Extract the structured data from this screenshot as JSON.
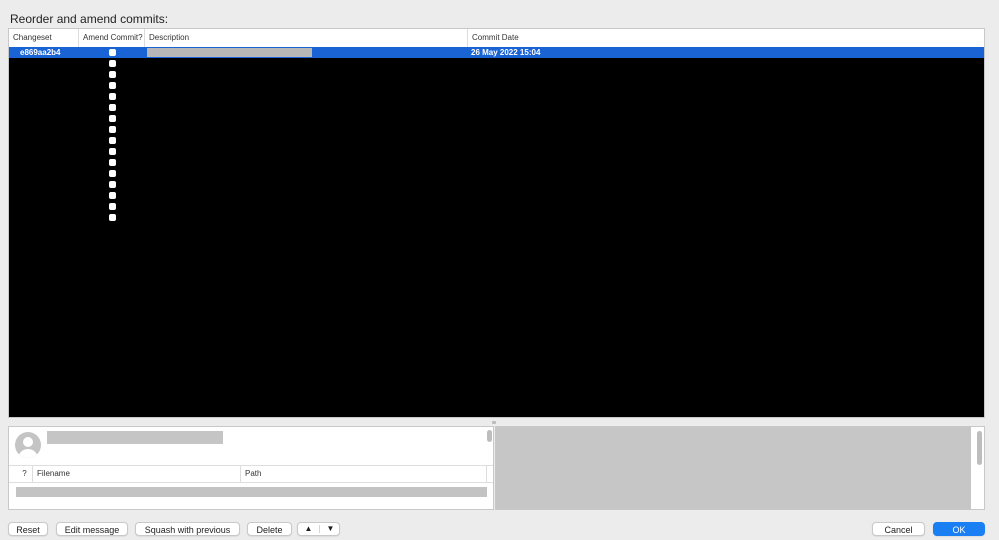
{
  "dialog": {
    "prompt": "Reorder and amend commits:"
  },
  "table": {
    "columns": {
      "changeset": "Changeset",
      "amend": "Amend Commit?",
      "description": "Description",
      "date": "Commit Date"
    },
    "selected_row": {
      "changeset": "e869aa2b4",
      "commit_date": "26 May 2022 15:04"
    }
  },
  "files": {
    "columns": {
      "status": "?",
      "filename": "Filename",
      "path": "Path"
    }
  },
  "buttons": {
    "reset": "Reset",
    "edit_message": "Edit message",
    "squash": "Squash with previous",
    "delete": "Delete",
    "move_up": "▲",
    "move_down": "▼",
    "cancel": "Cancel",
    "ok": "OK"
  },
  "colors": {
    "selection": "#1a63d4",
    "primary_button": "#1a7ff2"
  },
  "icons": [
    "avatar-placeholder-icon",
    "checkbox",
    "up-arrow",
    "down-arrow"
  ]
}
